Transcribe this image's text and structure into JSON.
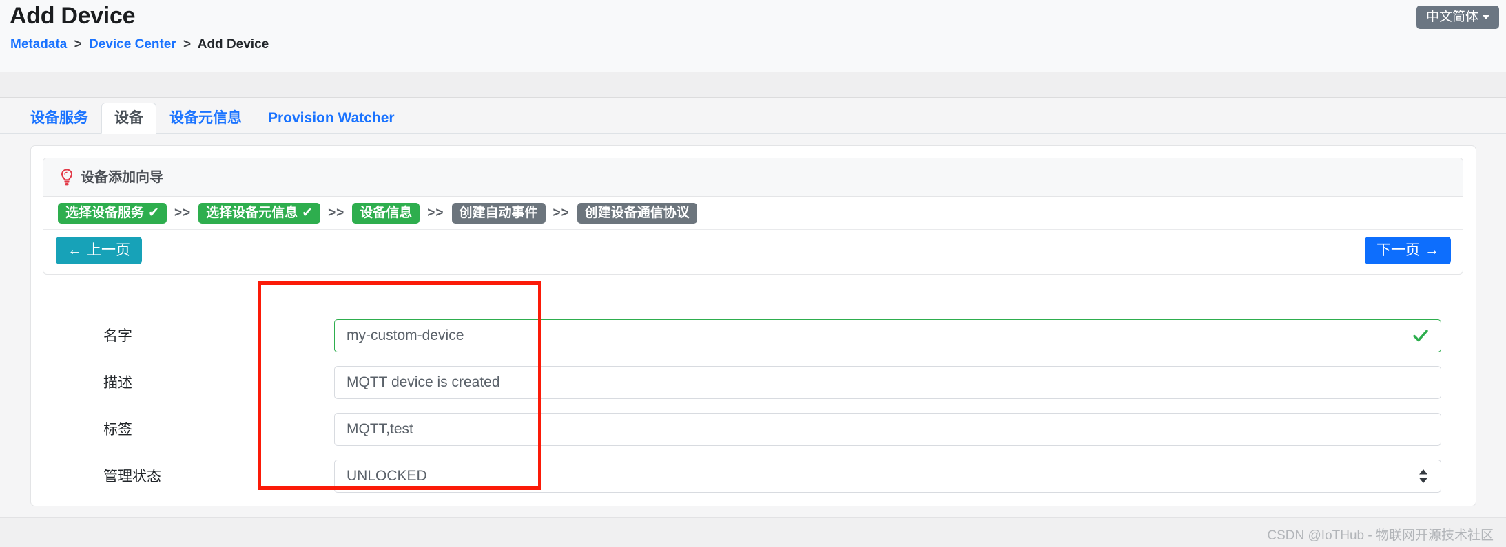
{
  "header": {
    "title": "Add Device",
    "breadcrumb": [
      {
        "label": "Metadata",
        "type": "link"
      },
      {
        "label": ">",
        "type": "sep"
      },
      {
        "label": "Device Center",
        "type": "link"
      },
      {
        "label": ">",
        "type": "sep"
      },
      {
        "label": "Add Device",
        "type": "current"
      }
    ],
    "language_button": "中文简体"
  },
  "tabs": [
    {
      "label": "设备服务",
      "active": false
    },
    {
      "label": "设备",
      "active": true
    },
    {
      "label": "设备元信息",
      "active": false
    },
    {
      "label": "Provision Watcher",
      "active": false
    }
  ],
  "wizard": {
    "icon": "lightbulb-icon",
    "title": "设备添加向导",
    "separator": ">>",
    "check_glyph": "✔",
    "steps": [
      {
        "label": "选择设备服务",
        "state": "done",
        "check": true
      },
      {
        "label": "选择设备元信息",
        "state": "done",
        "check": true
      },
      {
        "label": "设备信息",
        "state": "current",
        "check": false
      },
      {
        "label": "创建自动事件",
        "state": "todo",
        "check": false
      },
      {
        "label": "创建设备通信协议",
        "state": "todo",
        "check": false
      }
    ],
    "prev_button": {
      "arrow": "←",
      "label": "上一页"
    },
    "next_button": {
      "label": "下一页",
      "arrow": "→"
    }
  },
  "form": {
    "fields": [
      {
        "label": "名字",
        "value": "my-custom-device",
        "placeholder": "名字",
        "control": "text",
        "valid": true
      },
      {
        "label": "描述",
        "value": "MQTT device is created",
        "placeholder": "描述",
        "control": "text",
        "valid": false
      },
      {
        "label": "标签",
        "value": "MQTT,test",
        "placeholder": "标签",
        "control": "text",
        "valid": false
      },
      {
        "label": "管理状态",
        "value": "UNLOCKED",
        "placeholder": "管理状态",
        "control": "select",
        "valid": false
      }
    ]
  },
  "footer": {
    "watermark": "CSDN @IoTHub - 物联网开源技术社区"
  },
  "colors": {
    "link": "#1a73ff",
    "step_done": "#2eae4e",
    "step_todo": "#6c757d",
    "prev_button": "#17a2b8",
    "next_button": "#0d6efd",
    "annotation": "#fb1a08",
    "valid": "#2eae4e",
    "lang_button": "#6b7682"
  }
}
